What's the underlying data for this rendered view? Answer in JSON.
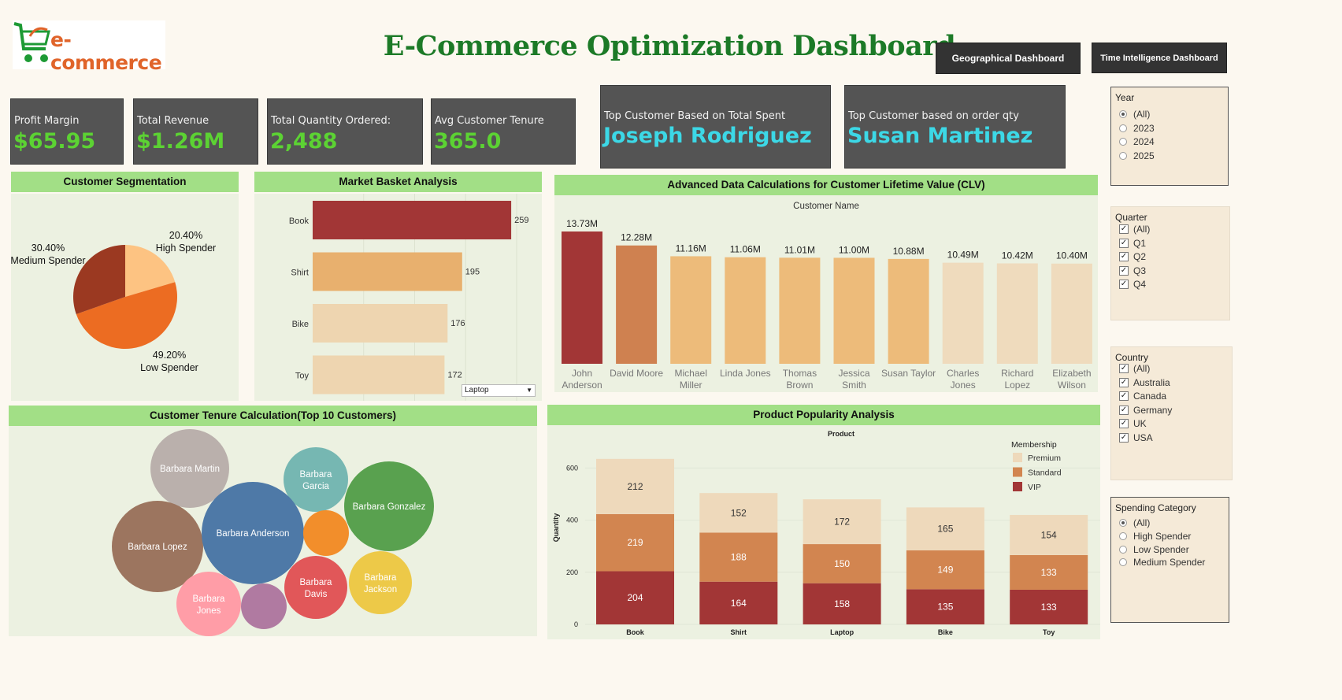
{
  "header": {
    "logo_text": "e-commerce",
    "title": "E-Commerce Optimization Dashboard",
    "nav": [
      {
        "label": "Geographical Dashboard"
      },
      {
        "label": "Time Intelligence Dashboard"
      }
    ]
  },
  "kpis": [
    {
      "label": "Profit Margin",
      "value": "$65.95"
    },
    {
      "label": "Total Revenue",
      "value": "$1.26M"
    },
    {
      "label": "Total Quantity Ordered:",
      "value": "2,488"
    },
    {
      "label": "Avg Customer Tenure",
      "value": "365.0"
    }
  ],
  "top_customers": [
    {
      "label": "Top Customer Based on Total Spent",
      "value": "Joseph Rodriguez"
    },
    {
      "label": "Top Customer based on order qty",
      "value": "Susan Martinez"
    }
  ],
  "panels": {
    "segmentation": "Customer Segmentation",
    "basket": "Market Basket Analysis",
    "clv": "Advanced Data Calculations for Customer Lifetime Value (CLV)",
    "tenure": "Customer Tenure Calculation(Top 10 Customers)",
    "popularity": "Product Popularity Analysis"
  },
  "basket_dropdown": "Laptop",
  "filters": {
    "year": {
      "title": "Year",
      "options": [
        "(All)",
        "2023",
        "2024",
        "2025"
      ],
      "selected": "(All)"
    },
    "quarter": {
      "title": "Quarter",
      "options": [
        "(All)",
        "Q1",
        "Q2",
        "Q3",
        "Q4"
      ]
    },
    "country": {
      "title": "Country",
      "options": [
        "(All)",
        "Australia",
        "Canada",
        "Germany",
        "UK",
        "USA"
      ]
    },
    "spending": {
      "title": "Spending Category",
      "options": [
        "(All)",
        "High Spender",
        "Low Spender",
        "Medium Spender"
      ],
      "selected": "(All)"
    }
  },
  "chart_data": [
    {
      "type": "pie",
      "title": "Customer Segmentation",
      "slices": [
        {
          "label": "High Spender",
          "value": 20.4,
          "text": "20.40%",
          "color": "#fdc382"
        },
        {
          "label": "Low Spender",
          "value": 49.2,
          "text": "49.20%",
          "color": "#ec6c22"
        },
        {
          "label": "Medium Spender",
          "value": 30.4,
          "text": "30.40%",
          "color": "#9b3921"
        }
      ]
    },
    {
      "type": "bar",
      "orientation": "horizontal",
      "title": "Market Basket Analysis",
      "categories": [
        "Book",
        "Shirt",
        "Bike",
        "Toy"
      ],
      "values": [
        259,
        195,
        176,
        172
      ],
      "colors": [
        "#a23636",
        "#e8b06e",
        "#eed5b0",
        "#eed5b0"
      ],
      "xlim": [
        0,
        300
      ]
    },
    {
      "type": "bar",
      "title": "Advanced Data Calculations for Customer Lifetime Value (CLV)",
      "xlabel": "Customer Name",
      "categories": [
        "John Anderson",
        "David Moore",
        "Michael Miller",
        "Linda Jones",
        "Thomas Brown",
        "Jessica Smith",
        "Susan Taylor",
        "Charles Jones",
        "Richard Lopez",
        "Elizabeth Wilson"
      ],
      "values": [
        13.73,
        12.28,
        11.16,
        11.06,
        11.01,
        11.0,
        10.88,
        10.49,
        10.42,
        10.4
      ],
      "labels": [
        "13.73M",
        "12.28M",
        "11.16M",
        "11.06M",
        "11.01M",
        "11.00M",
        "10.88M",
        "10.49M",
        "10.42M",
        "10.40M"
      ],
      "colors": [
        "#a23636",
        "#cf8150",
        "#edbb7a",
        "#edbb7a",
        "#edbb7a",
        "#edbb7a",
        "#edbb7a",
        "#efdbbd",
        "#efdbbd",
        "#efdbbd"
      ],
      "ylim": [
        0,
        14
      ]
    },
    {
      "type": "scatter",
      "subtype": "packed-bubble",
      "title": "Customer Tenure Calculation(Top 10 Customers)",
      "bubbles": [
        {
          "label": "Barbara Martin",
          "color": "#bab0ac"
        },
        {
          "label": "Barbara Garcia",
          "color": "#76b7b2"
        },
        {
          "label": "Barbara Gonzalez",
          "color": "#59a14f"
        },
        {
          "label": "Barbara Lopez",
          "color": "#9c755f"
        },
        {
          "label": "Barbara Anderson",
          "color": "#4e79a7"
        },
        {
          "label": "",
          "color": "#f28e2b"
        },
        {
          "label": "Barbara Davis",
          "color": "#e15759"
        },
        {
          "label": "Barbara Jackson",
          "color": "#edc948"
        },
        {
          "label": "Barbara Jones",
          "color": "#ff9da7"
        },
        {
          "label": "",
          "color": "#b07aa1"
        }
      ]
    },
    {
      "type": "bar",
      "stacked": true,
      "title": "Product Popularity Analysis",
      "xlabel": "Product",
      "ylabel": "Quantity",
      "legend_title": "Membership",
      "legend_position": "top-right",
      "categories": [
        "Book",
        "Shirt",
        "Laptop",
        "Bike",
        "Toy"
      ],
      "series": [
        {
          "name": "VIP",
          "color": "#a23636",
          "values": [
            204,
            164,
            158,
            135,
            133
          ]
        },
        {
          "name": "Standard",
          "color": "#d28550",
          "values": [
            219,
            188,
            150,
            149,
            133
          ]
        },
        {
          "name": "Premium",
          "color": "#eed9bb",
          "values": [
            212,
            152,
            172,
            165,
            154
          ]
        }
      ],
      "yticks": [
        0,
        200,
        400,
        600
      ],
      "ylim": [
        0,
        650
      ]
    }
  ]
}
